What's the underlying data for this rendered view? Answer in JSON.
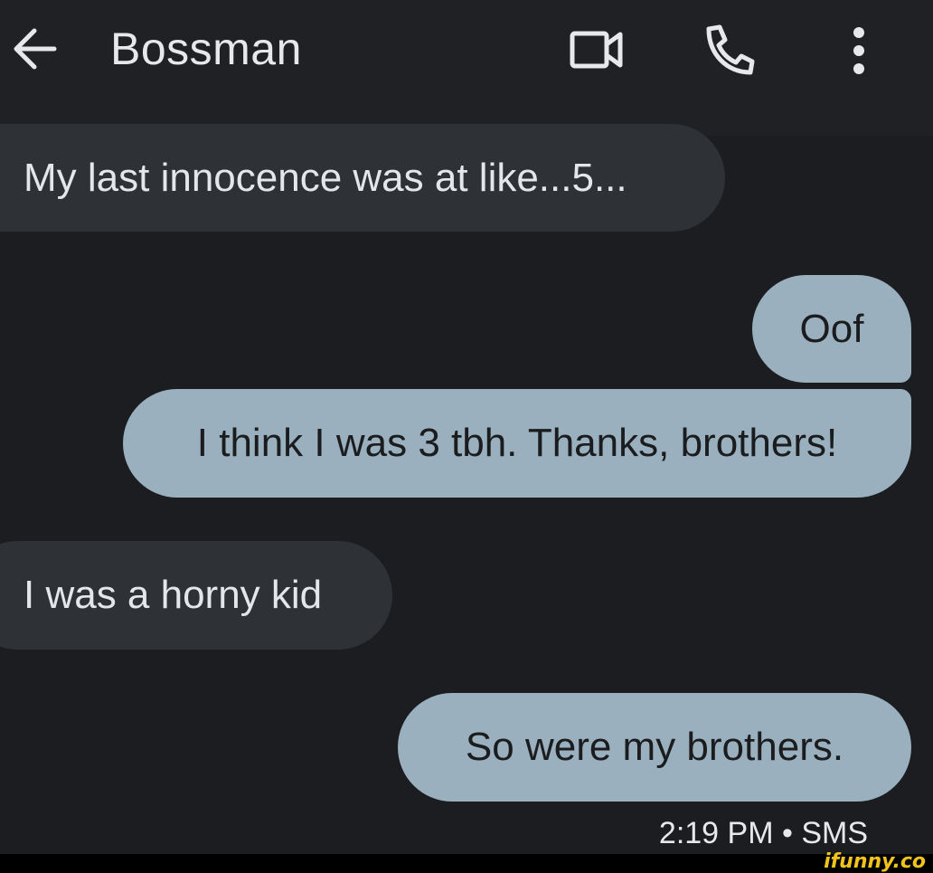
{
  "header": {
    "contact_name": "Bossman",
    "icons": [
      "arrow-back-icon",
      "video-call-icon",
      "phone-icon",
      "more-vert-icon"
    ]
  },
  "messages": [
    {
      "direction": "incoming",
      "text": "My last innocence was at like...5..."
    },
    {
      "direction": "outgoing",
      "text": "Oof"
    },
    {
      "direction": "outgoing",
      "text": "I think I was 3 tbh. Thanks, brothers!"
    },
    {
      "direction": "incoming",
      "text": "I was a horny kid"
    },
    {
      "direction": "outgoing",
      "text": "So were my brothers."
    }
  ],
  "status": {
    "timestamp": "2:19 PM • SMS"
  },
  "watermark": "ifunny.co",
  "colors": {
    "background": "#1b1d20",
    "incoming_bubble": "#2e3135",
    "outgoing_bubble": "#9ab0bf",
    "watermark": "#f2c31b"
  }
}
